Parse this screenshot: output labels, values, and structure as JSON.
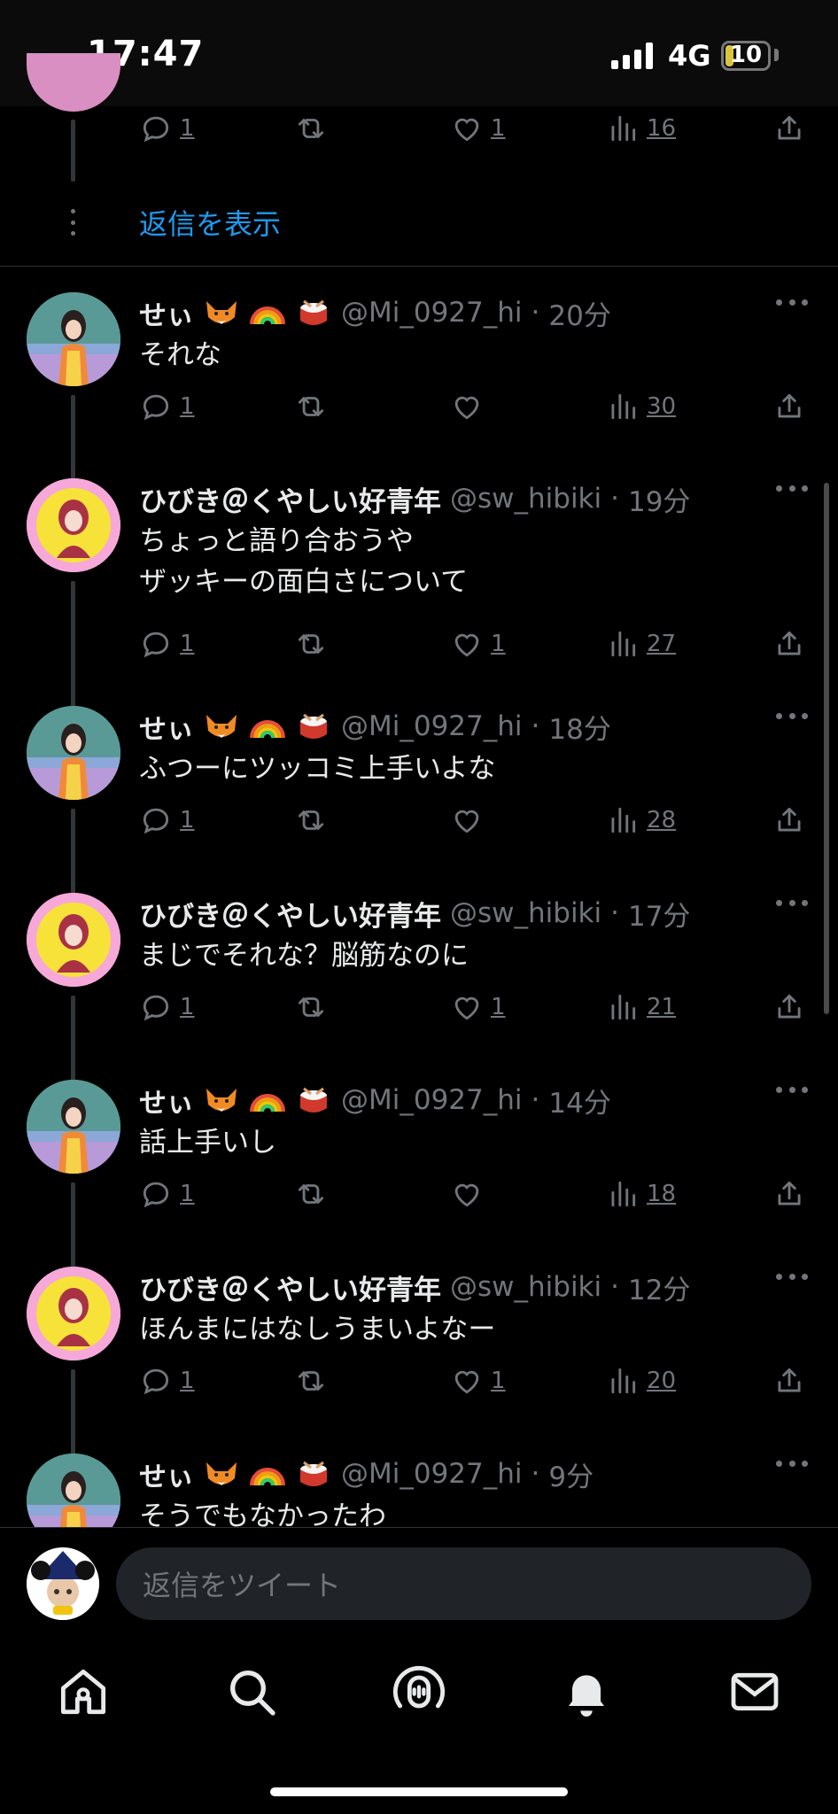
{
  "status": {
    "time": "17:47",
    "network": "4G",
    "battery": "10",
    "battery_level": 0.1
  },
  "show_replies": "返信を表示",
  "top_actions": {
    "replies": "1",
    "likes": "1",
    "views": "16"
  },
  "tweets": [
    {
      "name": "せぃ",
      "handle": "@Mi_0927_hi",
      "time": "20分",
      "text": "それな",
      "replies": "1",
      "likes": "",
      "views": "30"
    },
    {
      "name": "ひびき＠くやしい好青年",
      "handle": "@sw_hibiki",
      "time": "19分",
      "text": "ちょっと語り合おうや\nザッキーの面白さについて",
      "replies": "1",
      "likes": "1",
      "views": "27"
    },
    {
      "name": "せぃ",
      "handle": "@Mi_0927_hi",
      "time": "18分",
      "text": "ふつーにツッコミ上手いよな",
      "replies": "1",
      "likes": "",
      "views": "28"
    },
    {
      "name": "ひびき＠くやしい好青年",
      "handle": "@sw_hibiki",
      "time": "17分",
      "text": "まじでそれな？脳筋なのに",
      "replies": "1",
      "likes": "1",
      "views": "21"
    },
    {
      "name": "せぃ",
      "handle": "@Mi_0927_hi",
      "time": "14分",
      "text": "話上手いし",
      "replies": "1",
      "likes": "",
      "views": "18"
    },
    {
      "name": "ひびき＠くやしい好青年",
      "handle": "@sw_hibiki",
      "time": "12分",
      "text": "ほんまにはなしうまいよなー",
      "replies": "1",
      "likes": "1",
      "views": "20"
    },
    {
      "name": "せぃ",
      "handle": "@Mi_0927_hi",
      "time": "9分",
      "text": "そうでもなかったわ",
      "replies": "",
      "likes": "",
      "views": ""
    }
  ],
  "compose": {
    "placeholder": "返信をツイート"
  },
  "tabs": [
    "home-icon",
    "search-icon",
    "spaces-icon",
    "notifications-icon",
    "messages-icon"
  ],
  "colors": {
    "accent": "#1d9bf0",
    "muted": "#71767b",
    "background": "#000000"
  }
}
